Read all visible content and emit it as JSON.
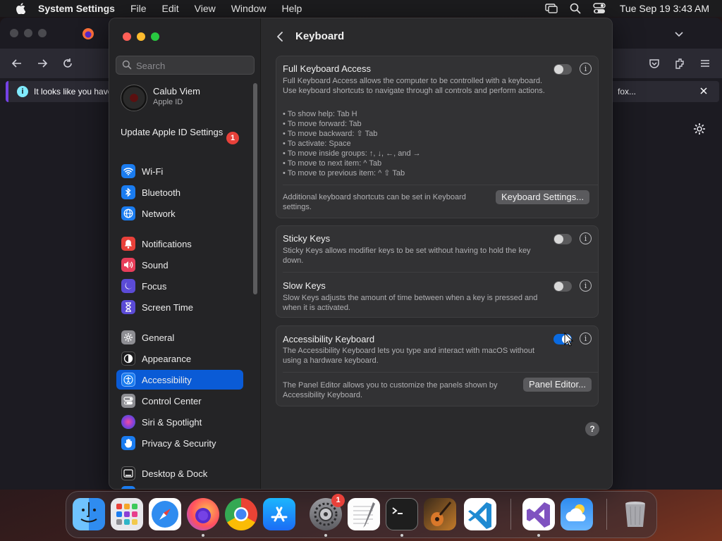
{
  "menubar": {
    "app_name": "System Settings",
    "menus": [
      "File",
      "Edit",
      "View",
      "Window",
      "Help"
    ],
    "clock": "Tue Sep 19  3:43 AM"
  },
  "browser": {
    "notice_text": "It looks like you have",
    "notice_right": "fox..."
  },
  "sidebar": {
    "search_placeholder": "Search",
    "account_name": "Calub Viem",
    "account_sub": "Apple ID",
    "update_label": "Update Apple ID Settings",
    "update_badge": "1",
    "items": [
      {
        "label": "Wi-Fi",
        "icon": "wifi-icon",
        "color": "#1a7cf0"
      },
      {
        "label": "Bluetooth",
        "icon": "bluetooth-icon",
        "color": "#1a7cf0"
      },
      {
        "label": "Network",
        "icon": "globe-icon",
        "color": "#1a7cf0"
      },
      {
        "label": "Notifications",
        "icon": "bell-icon",
        "color": "#e8413a"
      },
      {
        "label": "Sound",
        "icon": "speaker-icon",
        "color": "#e83e5a"
      },
      {
        "label": "Focus",
        "icon": "moon-icon",
        "color": "#5b4bd6"
      },
      {
        "label": "Screen Time",
        "icon": "hourglass-icon",
        "color": "#5b4bd6"
      },
      {
        "label": "General",
        "icon": "gear-icon",
        "color": "#8e8e93"
      },
      {
        "label": "Appearance",
        "icon": "appearance-icon",
        "color": "#1c1c1e"
      },
      {
        "label": "Accessibility",
        "icon": "accessibility-icon",
        "color": "#1a7cf0"
      },
      {
        "label": "Control Center",
        "icon": "control-center-icon",
        "color": "#8e8e93"
      },
      {
        "label": "Siri & Spotlight",
        "icon": "siri-icon",
        "color": "#8b3fd6"
      },
      {
        "label": "Privacy & Security",
        "icon": "hand-icon",
        "color": "#1a7cf0"
      },
      {
        "label": "Desktop & Dock",
        "icon": "dock-icon",
        "color": "#1c1c1e"
      }
    ]
  },
  "content": {
    "title": "Keyboard",
    "full_keyboard_access": {
      "title": "Full Keyboard Access",
      "desc": "Full Keyboard Access allows the computer to be controlled with a keyboard. Use keyboard shortcuts to navigate through all controls and perform actions.",
      "shortcuts": [
        "• To show help: Tab H",
        "• To move forward: Tab",
        "• To move backward: ⇧ Tab",
        "• To activate: Space",
        "• To move inside groups: ↑, ↓, ←, and →",
        "• To move to next item: ^ Tab",
        "• To move to previous item: ^ ⇧ Tab"
      ],
      "enabled": false,
      "footer_text": "Additional keyboard shortcuts can be set in Keyboard settings.",
      "button": "Keyboard Settings..."
    },
    "sticky_keys": {
      "title": "Sticky Keys",
      "desc": "Sticky Keys allows modifier keys to be set without having to hold the key down.",
      "enabled": false
    },
    "slow_keys": {
      "title": "Slow Keys",
      "desc": "Slow Keys adjusts the amount of time between when a key is pressed and when it is activated.",
      "enabled": false
    },
    "accessibility_keyboard": {
      "title": "Accessibility Keyboard",
      "desc": "The Accessibility Keyboard lets you type and interact with macOS without using a hardware keyboard.",
      "enabled": true,
      "footer_text": "The Panel Editor allows you to customize the panels shown by Accessibility Keyboard.",
      "button": "Panel Editor..."
    },
    "info_glyph": "i",
    "help_glyph": "?"
  },
  "dock": {
    "apps": [
      "Finder",
      "Launchpad",
      "Safari",
      "Firefox",
      "Chrome",
      "App Store",
      "System Settings",
      "TextEdit",
      "Terminal",
      "GarageBand",
      "Visual Studio Code",
      "Visual Studio",
      "Weather",
      "Trash"
    ],
    "settings_badge": "1"
  }
}
